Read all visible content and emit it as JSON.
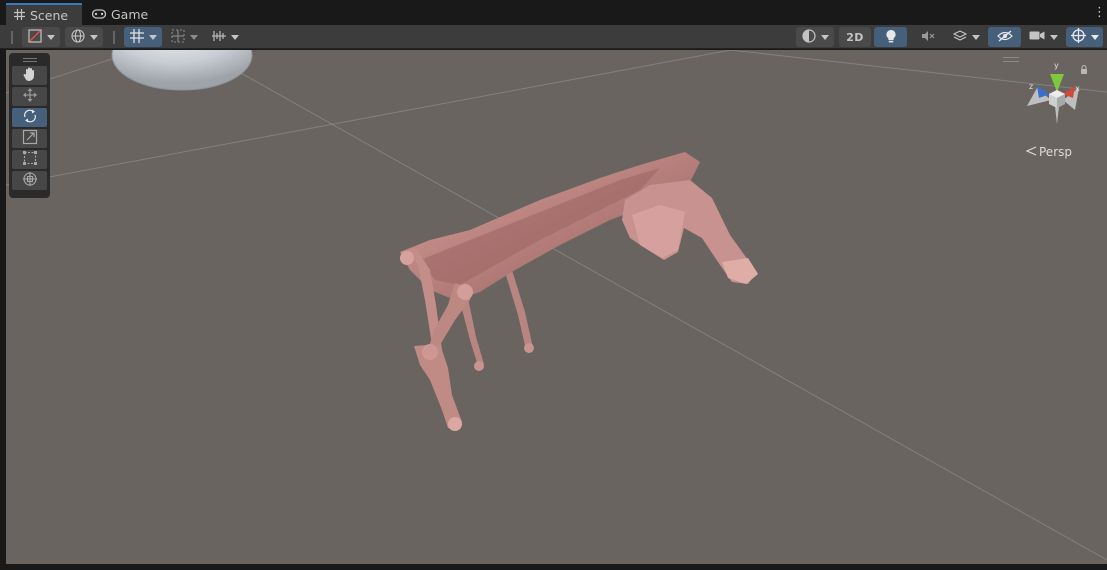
{
  "tabs": [
    {
      "label": "Scene",
      "icon": "hash-grid-icon",
      "active": true
    },
    {
      "label": "Game",
      "icon": "gamepad-icon",
      "active": false
    }
  ],
  "toolbar": {
    "left": [
      {
        "name": "draw-mode-button",
        "icon": "shaded-draw-icon",
        "has_dropdown": true
      },
      {
        "name": "global-local-button",
        "icon": "globe-icon",
        "has_dropdown": true
      },
      {
        "name": "grid-snap-button",
        "icon": "grid-snap-icon",
        "has_dropdown": true,
        "active": true
      },
      {
        "name": "snap-increment-button",
        "icon": "increment-snap-icon",
        "has_dropdown": true
      },
      {
        "name": "ruler-snap-button",
        "icon": "ruler-icon",
        "has_dropdown": true
      }
    ],
    "right": [
      {
        "name": "shading-mode-button",
        "icon": "shading-sphere-icon",
        "has_dropdown": true
      },
      {
        "name": "toggle-2d-button",
        "label": "2D"
      },
      {
        "name": "lighting-toggle-button",
        "icon": "lightbulb-icon",
        "active": true
      },
      {
        "name": "audio-toggle-button",
        "icon": "speaker-muted-icon"
      },
      {
        "name": "effects-button",
        "icon": "layers-icon",
        "has_dropdown": true
      },
      {
        "name": "scene-visibility-button",
        "icon": "eye-off-icon",
        "active": true
      },
      {
        "name": "camera-settings-button",
        "icon": "camera-icon",
        "has_dropdown": true
      },
      {
        "name": "gizmos-button",
        "icon": "gizmo-icon",
        "has_dropdown": true,
        "active": true
      }
    ]
  },
  "tools": [
    {
      "name": "hand-tool",
      "icon": "hand-icon",
      "active": false
    },
    {
      "name": "move-tool",
      "icon": "move-arrows-icon",
      "active": false
    },
    {
      "name": "rotate-tool",
      "icon": "rotate-icon",
      "active": true
    },
    {
      "name": "scale-tool",
      "icon": "scale-icon",
      "active": false
    },
    {
      "name": "rect-tool",
      "icon": "rect-transform-icon",
      "active": false
    },
    {
      "name": "transform-tool",
      "icon": "transform-all-icon",
      "active": false
    }
  ],
  "gizmo": {
    "axis_y": "y",
    "axis_x": "x",
    "axis_z": "z"
  },
  "view": {
    "projection_label": "Persp"
  },
  "colors": {
    "accent": "#3a79bb",
    "active_button": "#46607c",
    "scene_bg": "#6a6460",
    "axis_x": "#d14a3a",
    "axis_y": "#7fc83d",
    "axis_z": "#3a6fd1",
    "model": "#c58f8a"
  }
}
